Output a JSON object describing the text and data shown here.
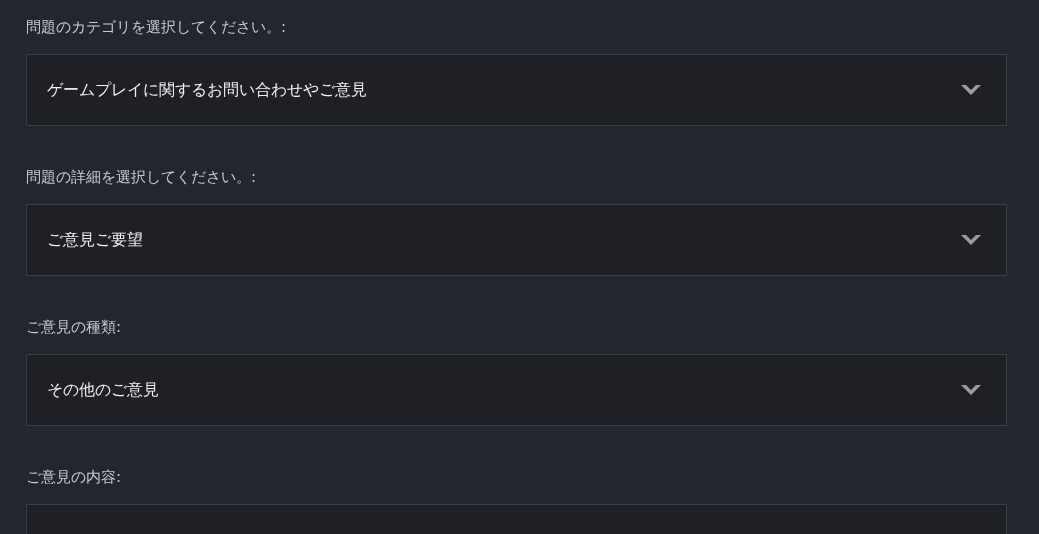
{
  "fields": [
    {
      "kind": "select",
      "label": "問題のカテゴリを選択してください。:",
      "value": "ゲームプレイに関するお問い合わせやご意見"
    },
    {
      "kind": "select",
      "label": "問題の詳細を選択してください。:",
      "value": "ご意見ご要望"
    },
    {
      "kind": "select",
      "label": "ご意見の種類:",
      "value": "その他のご意見"
    },
    {
      "kind": "textarea",
      "label": "ご意見の内容:"
    }
  ]
}
